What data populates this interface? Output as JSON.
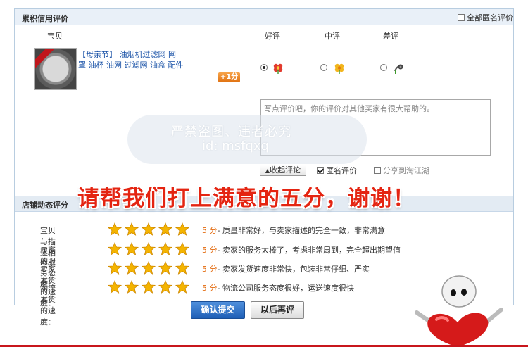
{
  "colors": {
    "accent_red": "#e42411",
    "link_blue": "#1750a6",
    "orange": "#e36a0d",
    "star": "#f4b400"
  },
  "review": {
    "section_title": "累积信用评价",
    "anon_all_label": "全部匿名评价",
    "anon_all_checked": false,
    "columns": {
      "item": "宝贝",
      "good": "好评",
      "neutral": "中评",
      "bad": "差评"
    },
    "product_line1": "【母亲节】    油烟机过滤网 网",
    "product_line2": "罩 油杯 油网 过滤网 油盒 配件",
    "plus_badge": "+1分",
    "selected": "good",
    "comment_placeholder": "写点评价吧，你的评价对其他买家有很大帮助的。",
    "collapse_label": "收起评论",
    "anonymous_label": "匿名评价",
    "anonymous_checked": true,
    "share_label": "分享到淘江湖",
    "share_checked": false
  },
  "watermark": {
    "line1": "严禁盗图、违者必究",
    "line2": "id: msfqxq"
  },
  "banner_text": "请帮我们打上满意的五分，谢谢！",
  "dsr": {
    "section_title": "店铺动态评分",
    "rows": [
      {
        "label": "宝贝与描述相符：",
        "stars": 5,
        "score": "5 分",
        "desc": "- 质量非常好，与卖家描述的完全一致，非常满意"
      },
      {
        "label": "卖家的服务态度：",
        "stars": 5,
        "score": "5 分",
        "desc": "- 卖家的服务太棒了，考虑非常周到，完全超出期望值"
      },
      {
        "label": "卖家发货的速度：",
        "stars": 5,
        "score": "5 分",
        "desc": "- 卖家发货速度非常快，包装非常仔细、严实"
      },
      {
        "label": "物流发货的速度：",
        "stars": 5,
        "score": "5 分",
        "desc": "- 物流公司服务态度很好，运送速度很快"
      }
    ]
  },
  "buttons": {
    "submit": "确认提交",
    "later": "以后再评"
  }
}
